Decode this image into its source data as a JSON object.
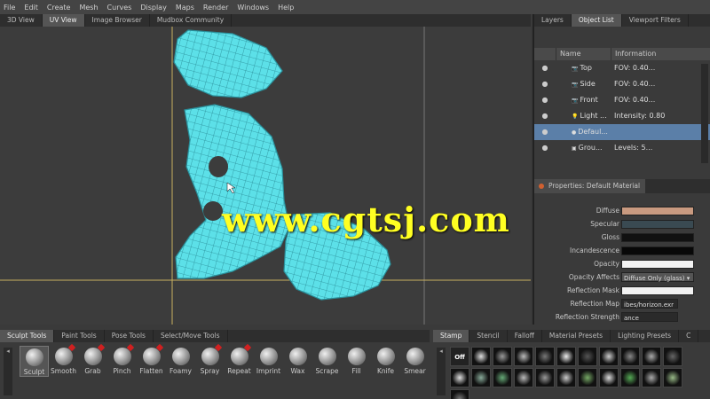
{
  "menu": [
    "File",
    "Edit",
    "Create",
    "Mesh",
    "Curves",
    "Display",
    "Maps",
    "Render",
    "Windows",
    "Help"
  ],
  "view_tabs": [
    {
      "label": "3D View",
      "active": false
    },
    {
      "label": "UV View",
      "active": true
    },
    {
      "label": "Image Browser",
      "active": false
    },
    {
      "label": "Mudbox Community",
      "active": false
    }
  ],
  "watermark": "www.cgtsj.com",
  "right_tabs": [
    {
      "label": "Layers",
      "active": false
    },
    {
      "label": "Object List",
      "active": true
    },
    {
      "label": "Viewport Filters",
      "active": false
    }
  ],
  "object_list": {
    "headers": {
      "name": "Name",
      "info": "Information"
    },
    "rows": [
      {
        "icon": "camera-icon",
        "name": "Top",
        "info": "FOV: 0.40...",
        "selected": false
      },
      {
        "icon": "camera-icon",
        "name": "Side",
        "info": "FOV: 0.40...",
        "selected": false
      },
      {
        "icon": "camera-icon",
        "name": "Front",
        "info": "FOV: 0.40...",
        "selected": false
      },
      {
        "icon": "light-icon",
        "name": "Light ...",
        "info": "Intensity: 0.80",
        "selected": false
      },
      {
        "icon": "material-icon",
        "name": "Defaul...",
        "info": "",
        "selected": true
      },
      {
        "icon": "group-icon",
        "name": "Grou...",
        "info": "Levels: 5...",
        "selected": false
      }
    ]
  },
  "properties": {
    "title": "Properties: Default Material",
    "rows": [
      {
        "label": "Diffuse",
        "kind": "swatch",
        "color": "#c99a80"
      },
      {
        "label": "Specular",
        "kind": "swatch",
        "color": "#3a4a52"
      },
      {
        "label": "Gloss",
        "kind": "swatch",
        "color": "#111111"
      },
      {
        "label": "Incandescence",
        "kind": "swatch",
        "color": "#080808"
      },
      {
        "label": "Opacity",
        "kind": "swatch",
        "color": "#f2f2f2"
      },
      {
        "label": "Opacity Affects",
        "kind": "dropdown",
        "value": "Diffuse Only (glass)"
      },
      {
        "label": "Reflection Mask",
        "kind": "swatch",
        "color": "#f2f2f2"
      },
      {
        "label": "Reflection Map",
        "kind": "text",
        "value": "ibes/horizon.exr"
      },
      {
        "label": "Reflection Strength",
        "kind": "text",
        "value": "ance"
      }
    ]
  },
  "tool_tabs": [
    {
      "label": "Sculpt Tools",
      "active": true
    },
    {
      "label": "Paint Tools",
      "active": false
    },
    {
      "label": "Pose Tools",
      "active": false
    },
    {
      "label": "Select/Move Tools",
      "active": false
    }
  ],
  "tools": [
    {
      "label": "Sculpt",
      "active": true,
      "mark": false
    },
    {
      "label": "Smooth",
      "active": false,
      "mark": true
    },
    {
      "label": "Grab",
      "active": false,
      "mark": true
    },
    {
      "label": "Pinch",
      "active": false,
      "mark": true
    },
    {
      "label": "Flatten",
      "active": false,
      "mark": true
    },
    {
      "label": "Foamy",
      "active": false,
      "mark": false
    },
    {
      "label": "Spray",
      "active": false,
      "mark": true
    },
    {
      "label": "Repeat",
      "active": false,
      "mark": true
    },
    {
      "label": "Imprint",
      "active": false,
      "mark": false
    },
    {
      "label": "Wax",
      "active": false,
      "mark": false
    },
    {
      "label": "Scrape",
      "active": false,
      "mark": false
    },
    {
      "label": "Fill",
      "active": false,
      "mark": false
    },
    {
      "label": "Knife",
      "active": false,
      "mark": false
    },
    {
      "label": "Smear",
      "active": false,
      "mark": false
    }
  ],
  "stamp_tabs": [
    {
      "label": "Stamp",
      "active": true
    },
    {
      "label": "Stencil",
      "active": false
    },
    {
      "label": "Falloff",
      "active": false
    },
    {
      "label": "Material Presets",
      "active": false
    },
    {
      "label": "Lighting Presets",
      "active": false
    },
    {
      "label": "C",
      "active": false
    }
  ],
  "stamp_off_label": "Off",
  "stamp_count": 22,
  "colors": {
    "mesh": "#5ce0e8",
    "mesh_line": "#2a8f9a",
    "selection": "#5b7fa8",
    "watermark": "#ffff22",
    "guide": "#c8b060"
  }
}
